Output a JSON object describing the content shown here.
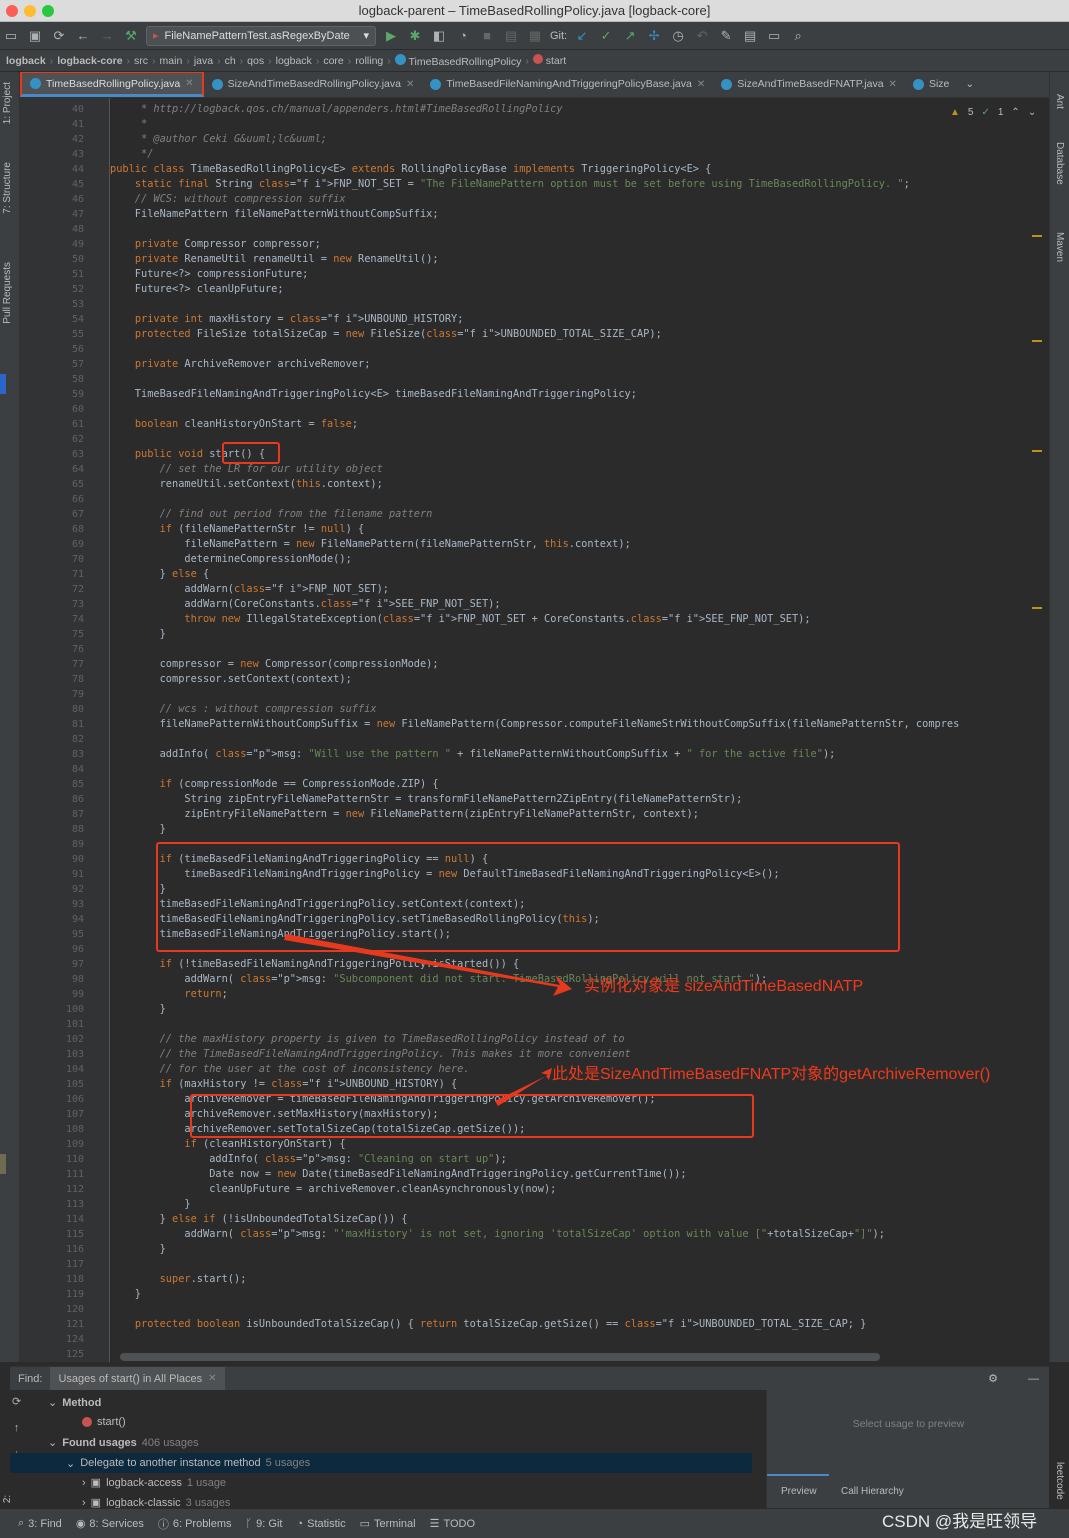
{
  "window": {
    "title": "logback-parent – TimeBasedRollingPolicy.java [logback-core]"
  },
  "toolbar": {
    "run_config": "FileNamePatternTest.asRegexByDate",
    "git_label": "Git:"
  },
  "breadcrumbs": [
    "logback",
    "logback-core",
    "src",
    "main",
    "java",
    "ch",
    "qos",
    "logback",
    "core",
    "rolling",
    "TimeBasedRollingPolicy",
    "start"
  ],
  "tabs": [
    {
      "label": "TimeBasedRollingPolicy.java",
      "active": true
    },
    {
      "label": "SizeAndTimeBasedRollingPolicy.java"
    },
    {
      "label": "TimeBasedFileNamingAndTriggeringPolicyBase.java"
    },
    {
      "label": "SizeAndTimeBasedFNATP.java"
    },
    {
      "label": "Size"
    }
  ],
  "side_labels": {
    "project": "1: Project",
    "structure": "7: Structure",
    "pull_requests": "Pull Requests",
    "favorites": "2: Favorites",
    "ant": "Ant",
    "database": "Database",
    "maven": "Maven",
    "leetcode": "leetcode"
  },
  "inspections": {
    "warnings": "5",
    "checks": "1"
  },
  "code_lines": [
    {
      "n": "40",
      "t": "     * http://logback.qos.ch/manual/appenders.html#TimeBasedRollingPolicy"
    },
    {
      "n": "41",
      "t": "     *"
    },
    {
      "n": "42",
      "t": "     * @author Ceki G&uuml;lc&uuml;"
    },
    {
      "n": "43",
      "t": "     */"
    },
    {
      "n": "44",
      "t": "public class TimeBasedRollingPolicy<E> extends RollingPolicyBase implements TriggeringPolicy<E> {"
    },
    {
      "n": "45",
      "t": "    static final String FNP_NOT_SET = \"The FileNamePattern option must be set before using TimeBasedRollingPolicy. \";"
    },
    {
      "n": "46",
      "t": "    // WCS: without compression suffix"
    },
    {
      "n": "47",
      "t": "    FileNamePattern fileNamePatternWithoutCompSuffix;"
    },
    {
      "n": "48",
      "t": ""
    },
    {
      "n": "49",
      "t": "    private Compressor compressor;"
    },
    {
      "n": "50",
      "t": "    private RenameUtil renameUtil = new RenameUtil();"
    },
    {
      "n": "51",
      "t": "    Future<?> compressionFuture;"
    },
    {
      "n": "52",
      "t": "    Future<?> cleanUpFuture;"
    },
    {
      "n": "53",
      "t": ""
    },
    {
      "n": "54",
      "t": "    private int maxHistory = UNBOUND_HISTORY;"
    },
    {
      "n": "55",
      "t": "    protected FileSize totalSizeCap = new FileSize(UNBOUNDED_TOTAL_SIZE_CAP);"
    },
    {
      "n": "56",
      "t": ""
    },
    {
      "n": "57",
      "t": "    private ArchiveRemover archiveRemover;"
    },
    {
      "n": "58",
      "t": ""
    },
    {
      "n": "59",
      "t": "    TimeBasedFileNamingAndTriggeringPolicy<E> timeBasedFileNamingAndTriggeringPolicy;"
    },
    {
      "n": "60",
      "t": ""
    },
    {
      "n": "61",
      "t": "    boolean cleanHistoryOnStart = false;"
    },
    {
      "n": "62",
      "t": ""
    },
    {
      "n": "63",
      "t": "    public void start() {"
    },
    {
      "n": "64",
      "t": "        // set the LR for our utility object"
    },
    {
      "n": "65",
      "t": "        renameUtil.setContext(this.context);"
    },
    {
      "n": "66",
      "t": ""
    },
    {
      "n": "67",
      "t": "        // find out period from the filename pattern"
    },
    {
      "n": "68",
      "t": "        if (fileNamePatternStr != null) {"
    },
    {
      "n": "69",
      "t": "            fileNamePattern = new FileNamePattern(fileNamePatternStr, this.context);"
    },
    {
      "n": "70",
      "t": "            determineCompressionMode();"
    },
    {
      "n": "71",
      "t": "        } else {"
    },
    {
      "n": "72",
      "t": "            addWarn(FNP_NOT_SET);"
    },
    {
      "n": "73",
      "t": "            addWarn(CoreConstants.SEE_FNP_NOT_SET);"
    },
    {
      "n": "74",
      "t": "            throw new IllegalStateException(FNP_NOT_SET + CoreConstants.SEE_FNP_NOT_SET);"
    },
    {
      "n": "75",
      "t": "        }"
    },
    {
      "n": "76",
      "t": ""
    },
    {
      "n": "77",
      "t": "        compressor = new Compressor(compressionMode);"
    },
    {
      "n": "78",
      "t": "        compressor.setContext(context);"
    },
    {
      "n": "79",
      "t": ""
    },
    {
      "n": "80",
      "t": "        // wcs : without compression suffix"
    },
    {
      "n": "81",
      "t": "        fileNamePatternWithoutCompSuffix = new FileNamePattern(Compressor.computeFileNameStrWithoutCompSuffix(fileNamePatternStr, compres"
    },
    {
      "n": "82",
      "t": ""
    },
    {
      "n": "83",
      "t": "        addInfo( msg: \"Will use the pattern \" + fileNamePatternWithoutCompSuffix + \" for the active file\");"
    },
    {
      "n": "84",
      "t": ""
    },
    {
      "n": "85",
      "t": "        if (compressionMode == CompressionMode.ZIP) {"
    },
    {
      "n": "86",
      "t": "            String zipEntryFileNamePatternStr = transformFileNamePattern2ZipEntry(fileNamePatternStr);"
    },
    {
      "n": "87",
      "t": "            zipEntryFileNamePattern = new FileNamePattern(zipEntryFileNamePatternStr, context);"
    },
    {
      "n": "88",
      "t": "        }"
    },
    {
      "n": "89",
      "t": ""
    },
    {
      "n": "90",
      "t": "        if (timeBasedFileNamingAndTriggeringPolicy == null) {"
    },
    {
      "n": "91",
      "t": "            timeBasedFileNamingAndTriggeringPolicy = new DefaultTimeBasedFileNamingAndTriggeringPolicy<E>();"
    },
    {
      "n": "92",
      "t": "        }"
    },
    {
      "n": "93",
      "t": "        timeBasedFileNamingAndTriggeringPolicy.setContext(context);"
    },
    {
      "n": "94",
      "t": "        timeBasedFileNamingAndTriggeringPolicy.setTimeBasedRollingPolicy(this);"
    },
    {
      "n": "95",
      "t": "        timeBasedFileNamingAndTriggeringPolicy.start();"
    },
    {
      "n": "96",
      "t": ""
    },
    {
      "n": "97",
      "t": "        if (!timeBasedFileNamingAndTriggeringPolicy.isStarted()) {"
    },
    {
      "n": "98",
      "t": "            addWarn( msg: \"Subcomponent did not start. TimeBasedRollingPolicy will not start.\");"
    },
    {
      "n": "99",
      "t": "            return;"
    },
    {
      "n": "100",
      "t": "        }"
    },
    {
      "n": "101",
      "t": ""
    },
    {
      "n": "102",
      "t": "        // the maxHistory property is given to TimeBasedRollingPolicy instead of to"
    },
    {
      "n": "103",
      "t": "        // the TimeBasedFileNamingAndTriggeringPolicy. This makes it more convenient"
    },
    {
      "n": "104",
      "t": "        // for the user at the cost of inconsistency here."
    },
    {
      "n": "105",
      "t": "        if (maxHistory != UNBOUND_HISTORY) {"
    },
    {
      "n": "106",
      "t": "            archiveRemover = timeBasedFileNamingAndTriggeringPolicy.getArchiveRemover();"
    },
    {
      "n": "107",
      "t": "            archiveRemover.setMaxHistory(maxHistory);"
    },
    {
      "n": "108",
      "t": "            archiveRemover.setTotalSizeCap(totalSizeCap.getSize());"
    },
    {
      "n": "109",
      "t": "            if (cleanHistoryOnStart) {"
    },
    {
      "n": "110",
      "t": "                addInfo( msg: \"Cleaning on start up\");"
    },
    {
      "n": "111",
      "t": "                Date now = new Date(timeBasedFileNamingAndTriggeringPolicy.getCurrentTime());"
    },
    {
      "n": "112",
      "t": "                cleanUpFuture = archiveRemover.cleanAsynchronously(now);"
    },
    {
      "n": "113",
      "t": "            }"
    },
    {
      "n": "114",
      "t": "        } else if (!isUnboundedTotalSizeCap()) {"
    },
    {
      "n": "115",
      "t": "            addWarn( msg: \"'maxHistory' is not set, ignoring 'totalSizeCap' option with value [\"+totalSizeCap+\"]\");"
    },
    {
      "n": "116",
      "t": "        }"
    },
    {
      "n": "117",
      "t": ""
    },
    {
      "n": "118",
      "t": "        super.start();"
    },
    {
      "n": "119",
      "t": "    }"
    },
    {
      "n": "120",
      "t": ""
    },
    {
      "n": "121",
      "t": "    protected boolean isUnboundedTotalSizeCap() { return totalSizeCap.getSize() == UNBOUNDED_TOTAL_SIZE_CAP; }"
    },
    {
      "n": "124",
      "t": ""
    },
    {
      "n": "125",
      "t": ""
    }
  ],
  "annotations": {
    "instantiated": "实例化对象是 sizeAndTimeBasedNATP",
    "here": "此处是SizeAndTimeBasedFNATP对象的getArchiveRemover()"
  },
  "find": {
    "label": "Find:",
    "tab": "Usages of start() in All Places",
    "method_header": "Method",
    "method_item": "start()",
    "found_label": "Found usages",
    "found_count": "406 usages",
    "delegate_label": "Delegate to another instance method",
    "delegate_count": "5 usages",
    "access_label": "logback-access",
    "access_count": "1 usage",
    "classic_label": "logback-classic",
    "classic_count": "3 usages",
    "preview_hint": "Select usage to preview",
    "preview_tab": "Preview",
    "hierarchy_tab": "Call Hierarchy"
  },
  "bottom_bar": [
    "3: Find",
    "8: Services",
    "6: Problems",
    "9: Git",
    "Statistic",
    "Terminal",
    "TODO"
  ],
  "watermark": "CSDN @我是旺领导"
}
